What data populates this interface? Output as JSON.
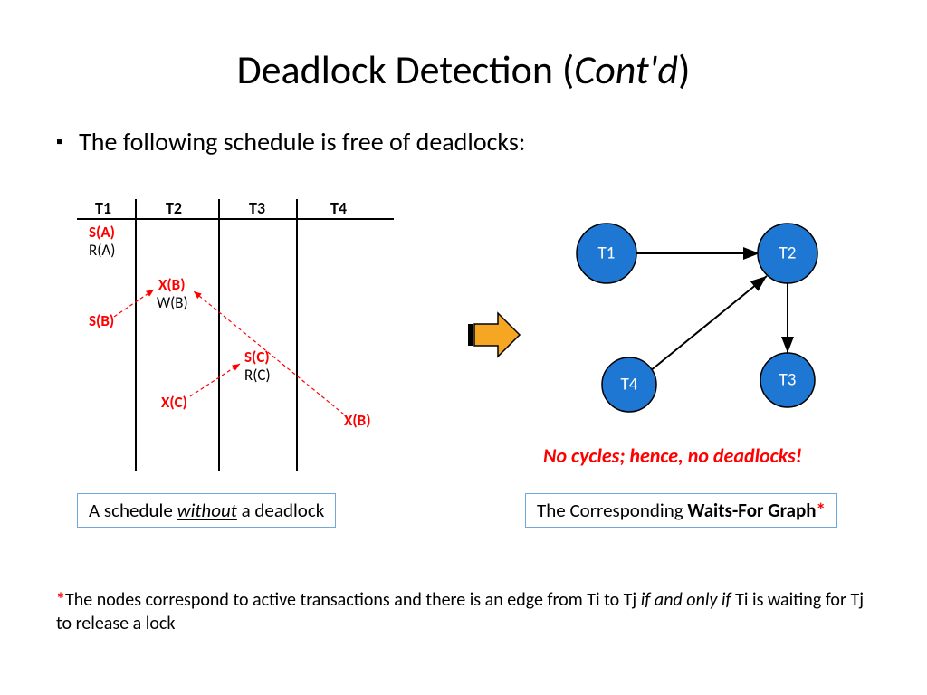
{
  "title_main": "Deadlock Detection (",
  "title_italic": "Cont'd",
  "title_end": ")",
  "bullet_text": "The following schedule is free of deadlocks:",
  "schedule": {
    "headers": [
      "T1",
      "T2",
      "T3",
      "T4"
    ],
    "col1": [
      "S(A)",
      "R(A)",
      "S(B)"
    ],
    "col2": [
      "X(B)",
      "W(B)",
      "X(C)"
    ],
    "col3": [
      "S(C)",
      "R(C)"
    ],
    "col4": [
      "X(B)"
    ]
  },
  "graph": {
    "nodes": [
      "T1",
      "T2",
      "T3",
      "T4"
    ],
    "edges": [
      [
        "T1",
        "T2"
      ],
      [
        "T4",
        "T2"
      ],
      [
        "T2",
        "T3"
      ]
    ]
  },
  "no_cycles_text": "No cycles; hence, no deadlocks!",
  "caption_left_a": "A schedule ",
  "caption_left_b": "without",
  "caption_left_c": " a deadlock",
  "caption_right_a": "The Corresponding ",
  "caption_right_b": "Waits-For Graph",
  "footnote_star": "*",
  "footnote_a": "The nodes correspond to active transactions and there is an edge from Ti to Tj ",
  "footnote_b": "if and only if",
  "footnote_c": " Ti is waiting for Tj to release a lock"
}
